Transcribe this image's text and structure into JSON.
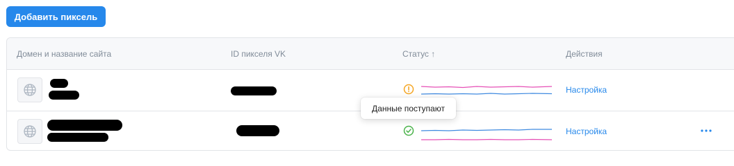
{
  "toolbar": {
    "add_pixel_label": "Добавить пиксель"
  },
  "table": {
    "headers": {
      "domain": "Домен и название сайта",
      "pixel_id": "ID пикселя VK",
      "status": "Статус ↑",
      "actions": "Действия"
    },
    "rows": [
      {
        "status_icon": "warning-icon",
        "action_label": "Настройка"
      },
      {
        "status_icon": "check-circle-icon",
        "action_label": "Настройка",
        "has_more_menu": true
      }
    ]
  },
  "tooltip": {
    "text": "Данные поступают"
  },
  "colors": {
    "accent": "#2688eb",
    "warning": "#f5a623",
    "success": "#4bb34b",
    "spark_pink": "#e64fb6",
    "spark_blue": "#3f8ae0"
  }
}
